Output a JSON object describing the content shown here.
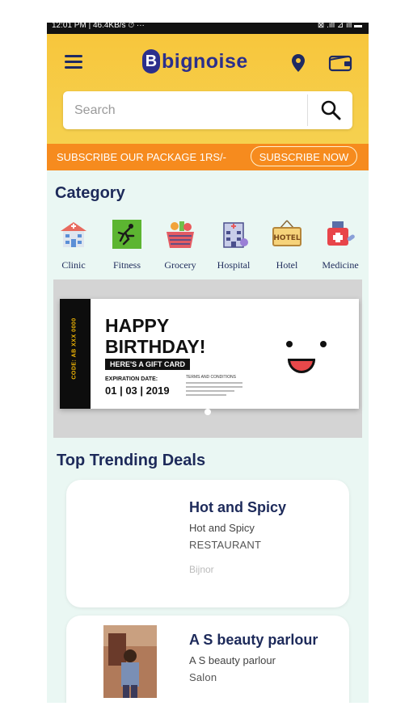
{
  "status_bar": {
    "time": "12:01 PM | 46.4KB/s ⏱ ···",
    "indicators": "⊠ .ıll ⊿ ıll ▬"
  },
  "header": {
    "logo_mark": "B",
    "logo_text": "bignoise",
    "icons": [
      "menu-icon",
      "location-pin-icon",
      "wallet-icon"
    ],
    "colors": {
      "header_bg": "#f7c63c",
      "brand": "#2b2f8c"
    }
  },
  "search": {
    "placeholder": "Search",
    "value": ""
  },
  "subscribe": {
    "text": "SUBSCRIBE OUR PACKAGE 1RS/-",
    "button": "SUBSCRIBE NOW",
    "bg": "#f68b1e"
  },
  "category": {
    "title": "Category",
    "items": [
      {
        "label": "Clinic",
        "icon": "clinic-icon"
      },
      {
        "label": "Fitness",
        "icon": "fitness-icon"
      },
      {
        "label": "Grocery",
        "icon": "grocery-basket-icon"
      },
      {
        "label": "Hospital",
        "icon": "hospital-icon"
      },
      {
        "label": "Hotel",
        "icon": "hotel-sign-icon"
      },
      {
        "label": "Medicine",
        "icon": "medicine-kit-icon"
      }
    ]
  },
  "banner": {
    "stub_code": "CODE: AB XXX 0000",
    "line1": "HAPPY",
    "line2": "BIRTHDAY!",
    "giftcard": "HERE'S A GIFT CARD",
    "expiration_label": "EXPIRATION DATE:",
    "expiration_date": "01 | 03 | 2019",
    "terms": "TERMS AND CONDITIONS",
    "active_slide": 1,
    "slide_count": 1
  },
  "trending": {
    "title": "Top Trending Deals",
    "deals": [
      {
        "name": "Hot and Spicy",
        "subtitle": "Hot and Spicy",
        "category": "RESTAURANT",
        "city": "Bijnor"
      },
      {
        "name": "A S beauty parlour",
        "subtitle": "A S beauty parlour",
        "category": "Salon",
        "city": ""
      }
    ]
  }
}
